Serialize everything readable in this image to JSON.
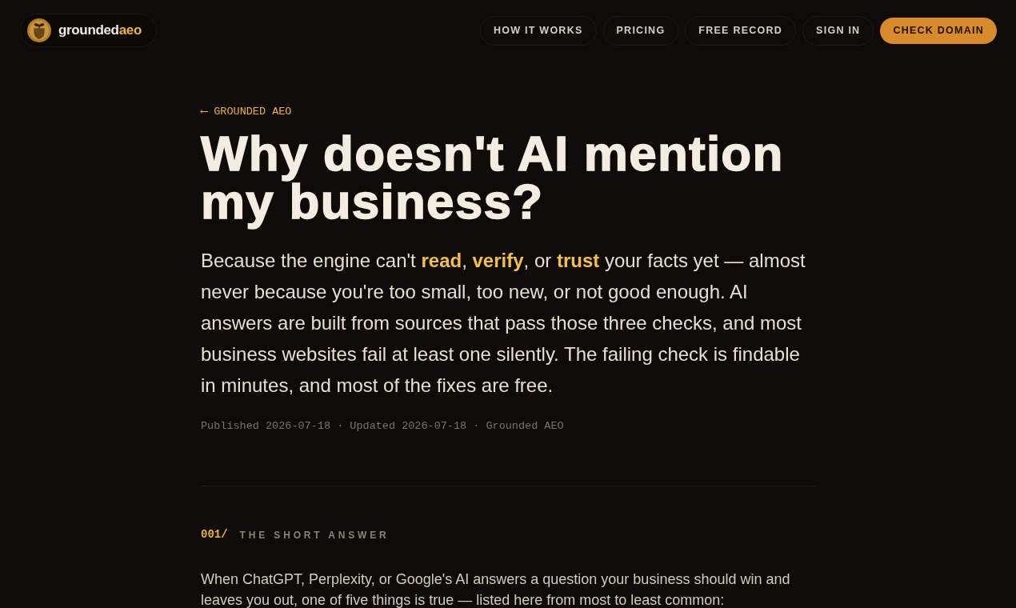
{
  "nav": {
    "logo": {
      "text_main": "grounded",
      "text_accent": "aeo"
    },
    "links": [
      {
        "label": "HOW IT WORKS",
        "kind": "link"
      },
      {
        "label": "PRICING",
        "kind": "link"
      },
      {
        "label": "FREE RECORD",
        "kind": "link"
      },
      {
        "label": "SIGN IN",
        "kind": "link"
      },
      {
        "label": "CHECK DOMAIN",
        "kind": "cta"
      }
    ]
  },
  "article": {
    "back_link": "⟵ GROUNDED AEO",
    "title": "Why doesn't AI mention my business?",
    "lede": "Because the engine can't **read**, **verify**, or **trust** your facts yet — almost never because you're too small, too new, or not good enough. AI answers are built from sources that pass those three checks, and most business websites fail at least one silently. The failing check is findable in minutes, and most of the fixes are free.",
    "meta": "Published 2026-07-18 · Updated 2026-07-18 · Grounded AEO",
    "sections": [
      {
        "number": "001/",
        "title": "THE SHORT ANSWER",
        "body": "When ChatGPT, Perplexity, or Google's AI answers a question your business should win and leaves you out, one of five things is true — listed here from most to least common:"
      }
    ]
  }
}
